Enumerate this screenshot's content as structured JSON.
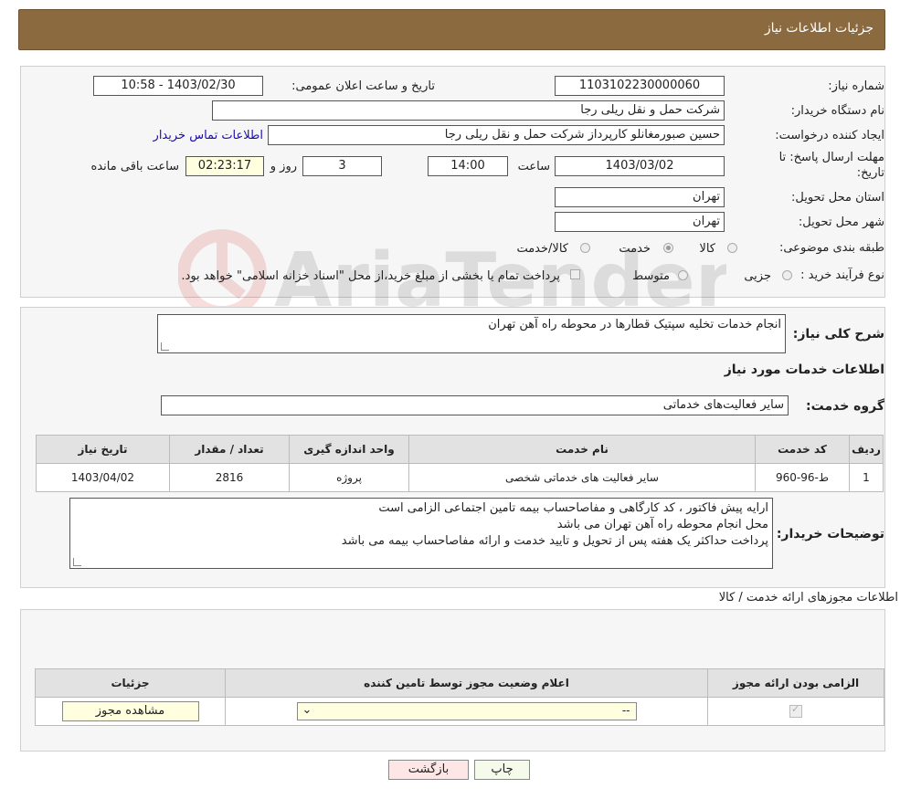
{
  "header": {
    "title": "جزئیات اطلاعات نیاز"
  },
  "form": {
    "need_number_label": "شماره نیاز:",
    "need_number": "1103102230000060",
    "announce_label": "تاریخ و ساعت اعلان عمومی:",
    "announce_value": "1403/02/30 - 10:58",
    "buyer_org_label": "نام دستگاه خریدار:",
    "buyer_org": "شرکت حمل و نقل ریلی رجا",
    "creator_label": "ایجاد کننده درخواست:",
    "creator": "حسین صبورمغانلو کارپرداز شرکت حمل و نقل ریلی رجا",
    "contact_link": "اطلاعات تماس خریدار",
    "deadline_label_1": "مهلت ارسال پاسخ: تا",
    "deadline_label_2": "تاریخ:",
    "deadline_date": "1403/03/02",
    "hour_label": "ساعت",
    "deadline_time": "14:00",
    "days": "3",
    "days_label": "روز و",
    "remaining": "02:23:17",
    "remaining_label": "ساعت باقی مانده",
    "province_label": "استان محل تحویل:",
    "province": "تهران",
    "city_label": "شهر محل تحویل:",
    "city": "تهران",
    "category_label": "طبقه بندی موضوعی:",
    "category_options": [
      "کالا",
      "خدمت",
      "کالا/خدمت"
    ],
    "category_selected": "خدمت",
    "process_label": "نوع فرآیند خرید :",
    "process_options": [
      "جزیی",
      "متوسط"
    ],
    "payment_note": "پرداخت تمام یا بخشی از مبلغ خرید،از محل \"اسناد خزانه اسلامی\" خواهد بود."
  },
  "summary": {
    "label": "شرح کلی نیاز:",
    "text": "انجام خدمات تخلیه سپتیک قطارها در محوطه راه آهن تهران",
    "services_heading": "اطلاعات خدمات مورد نیاز",
    "group_label": "گروه خدمت:",
    "group_value": "سایر فعالیت‌های خدماتی"
  },
  "services_table": {
    "headers": [
      "ردیف",
      "کد خدمت",
      "نام خدمت",
      "واحد اندازه گیری",
      "تعداد / مقدار",
      "تاریخ نیاز"
    ],
    "rows": [
      [
        "1",
        "ط-96-960",
        "سایر فعالیت های خدماتی شخصی",
        "پروژه",
        "2816",
        "1403/04/02"
      ]
    ]
  },
  "buyer_notes": {
    "label": "توضیحات خریدار:",
    "lines": [
      "ارایه پیش فاکتور ، کد کارگاهی  و مفاصاحساب بیمه تامین اجتماعی الزامی است",
      "محل انجام محوطه راه آهن تهران می باشد",
      "پرداخت حداکثر یک هفته پس از تحویل و تایید خدمت و ارائه مفاصاحساب بیمه می باشد"
    ]
  },
  "permits": {
    "heading": "اطلاعات مجوزهای ارائه خدمت / کالا",
    "headers": [
      "الزامی بودن ارائه مجوز",
      "اعلام وضعیت مجوز توسط تامین کننده",
      "جزئیات"
    ],
    "select_value": "--",
    "view_button": "مشاهده مجوز"
  },
  "footer": {
    "print": "چاپ",
    "back": "بازگشت"
  },
  "watermark": "AriaTender.net"
}
